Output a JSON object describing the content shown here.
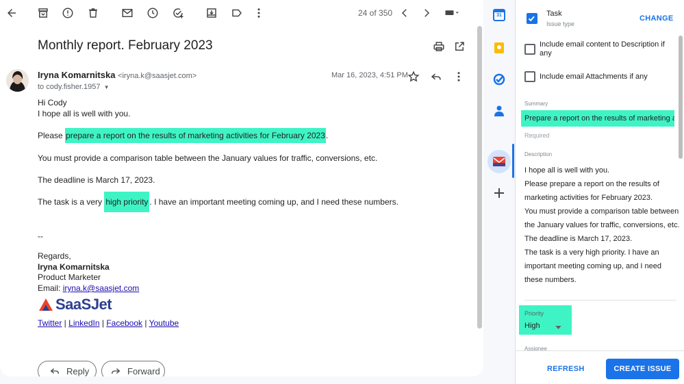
{
  "toolbar": {
    "page_count": "24 of 350"
  },
  "email": {
    "subject": "Monthly report. February 2023",
    "sender_name": "Iryna Komarnitska",
    "sender_email": "<iryna.k@saasjet.com>",
    "to": "to cody.fisher.1957",
    "date": "Mar 16, 2023, 4:51 PM",
    "greeting": "Hi Cody",
    "line1": "I hope all is well with you.",
    "p2_pre": "Please ",
    "p2_hl": "prepare a report on the results of marketing activities for February 2023",
    "p2_post": ".",
    "p3": "You must provide a comparison table between the January values for traffic, conversions, etc.",
    "p4": "The deadline is March 17, 2023.",
    "p5_pre": "The task is a very ",
    "p5_hl": "high priority",
    "p5_post": ". I have an important meeting coming up, and I need these numbers.",
    "sig_dash": "--",
    "sig_regards": "Regards,",
    "sig_name": "Iryna Komarnitska",
    "sig_title": "Product Marketer",
    "sig_email_label": "Email: ",
    "sig_email": "iryna.k@saasjet.com",
    "logo_text": "SaaSJet",
    "social": [
      "Twitter",
      "LinkedIn",
      "Facebook",
      "Youtube"
    ],
    "reply_label": "Reply",
    "forward_label": "Forward"
  },
  "strip": {
    "calendar_day": "31"
  },
  "panel": {
    "issue_type": "Task",
    "issue_type_label": "Issue type",
    "change_label": "CHANGE",
    "include_content": "Include email content to Description if any",
    "include_attachments": "Include email Attachments if any",
    "summary_label": "Summary",
    "summary_value": "Prepare a report on the results of marketing ac",
    "required_label": "Required",
    "description_label": "Description",
    "description_lines": [
      "I hope all is well with you.",
      "Please prepare a report on the results of",
      "marketing activities for February 2023.",
      "You must provide a comparison table between",
      "the January values for traffic, conversions, etc.",
      "The deadline is March 17, 2023.",
      "The task is a very high priority. I have an",
      "important meeting coming up, and I need",
      "these numbers."
    ],
    "priority_label": "Priority",
    "priority_value": "High",
    "assignee_label": "Assignee",
    "refresh_label": "REFRESH",
    "create_label": "CREATE ISSUE"
  },
  "colors": {
    "highlight": "#3ff4c4",
    "accent_blue": "#1a73e8",
    "logo_red": "#e8452c",
    "logo_blue": "#2e3f8f"
  }
}
